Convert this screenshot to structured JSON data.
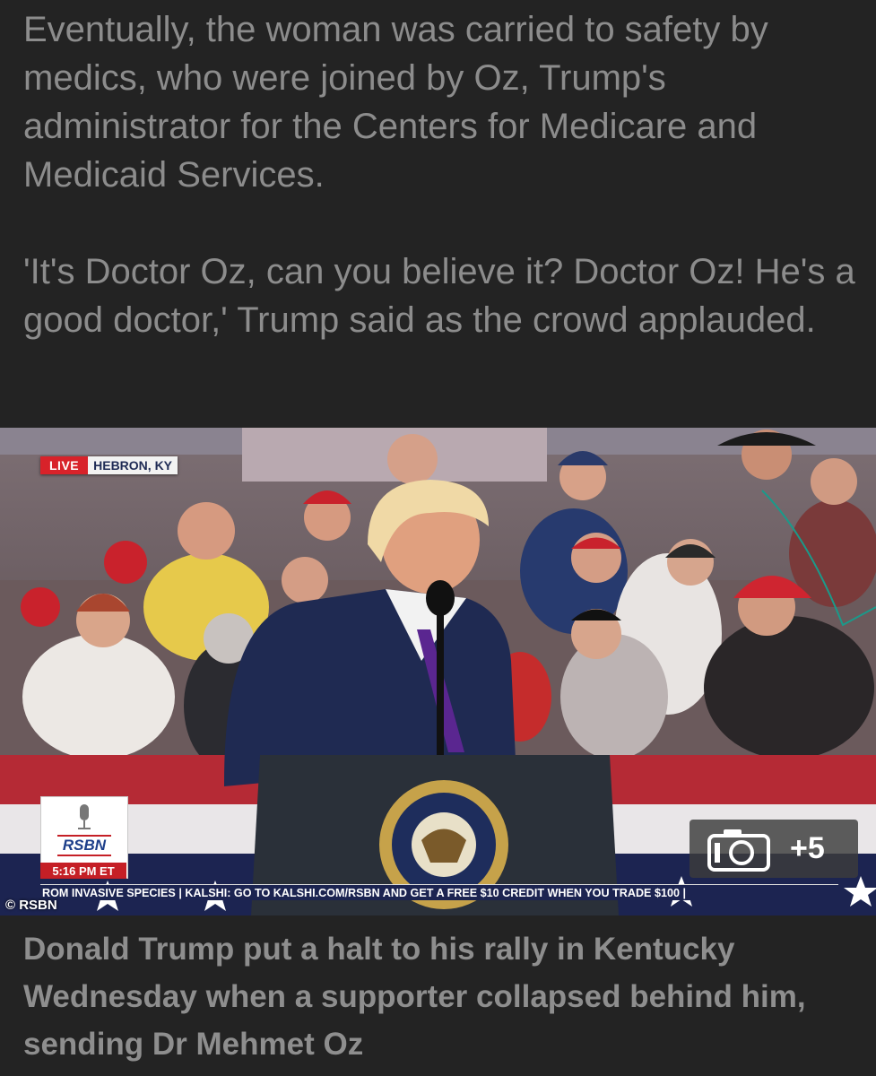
{
  "article": {
    "paragraphs": [
      "Eventually, the woman was carried to safety by medics, who were joined by Oz, Trump's administrator for the Centers for Medicare and Medicaid Services.",
      "'It's Doctor Oz, can you believe it? Doctor Oz! He's a good doctor,' Trump said as the crowd applauded."
    ]
  },
  "photo": {
    "live_label": "LIVE",
    "location": "HEBRON, KY",
    "network": "RSBN",
    "time": "5:16 PM ET",
    "ticker": "ROM INVASIVE SPECIES | KALSHI: GO TO KALSHI.COM/RSBN AND GET A FREE $10 CREDIT WHEN YOU TRADE $100 |",
    "copyright": "© RSBN",
    "gallery_count": "+5",
    "icons": [
      "camera-icon",
      "microphone-icon",
      "presidential-seal"
    ],
    "colors": {
      "live": "#d8222a",
      "ticker": "#1c2451",
      "banner_red": "#b52a35",
      "banner_blue": "#1c2451"
    }
  },
  "caption": "Donald Trump put a halt to his rally in Kentucky Wednesday when a supporter collapsed behind him, sending Dr Mehmet Oz"
}
